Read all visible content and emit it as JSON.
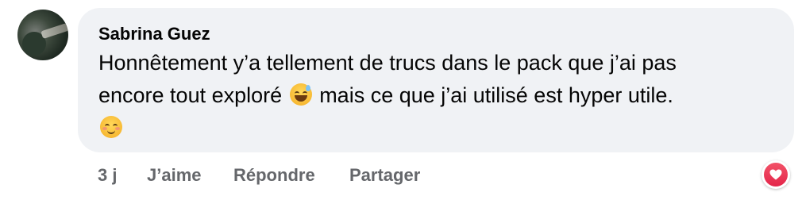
{
  "comment": {
    "author": "Sabrina Guez",
    "text_line1": "Honnêtement y’a tellement de trucs dans le pack que j’ai pas",
    "text_line2_before": "encore tout exploré",
    "text_line2_after": "mais ce que j’ai utilisé est hyper utile.",
    "emoji1": "sweat-smile-emoji",
    "emoji2": "blush-smile-emoji"
  },
  "actions": {
    "time": "3 j",
    "like": "J’aime",
    "reply": "Répondre",
    "share": "Partager"
  },
  "reaction": {
    "icon": "heart-icon",
    "color": "#e4254a"
  },
  "colors": {
    "bubble_bg": "#f0f2f5",
    "action_text": "#65676b",
    "text": "#050505"
  }
}
